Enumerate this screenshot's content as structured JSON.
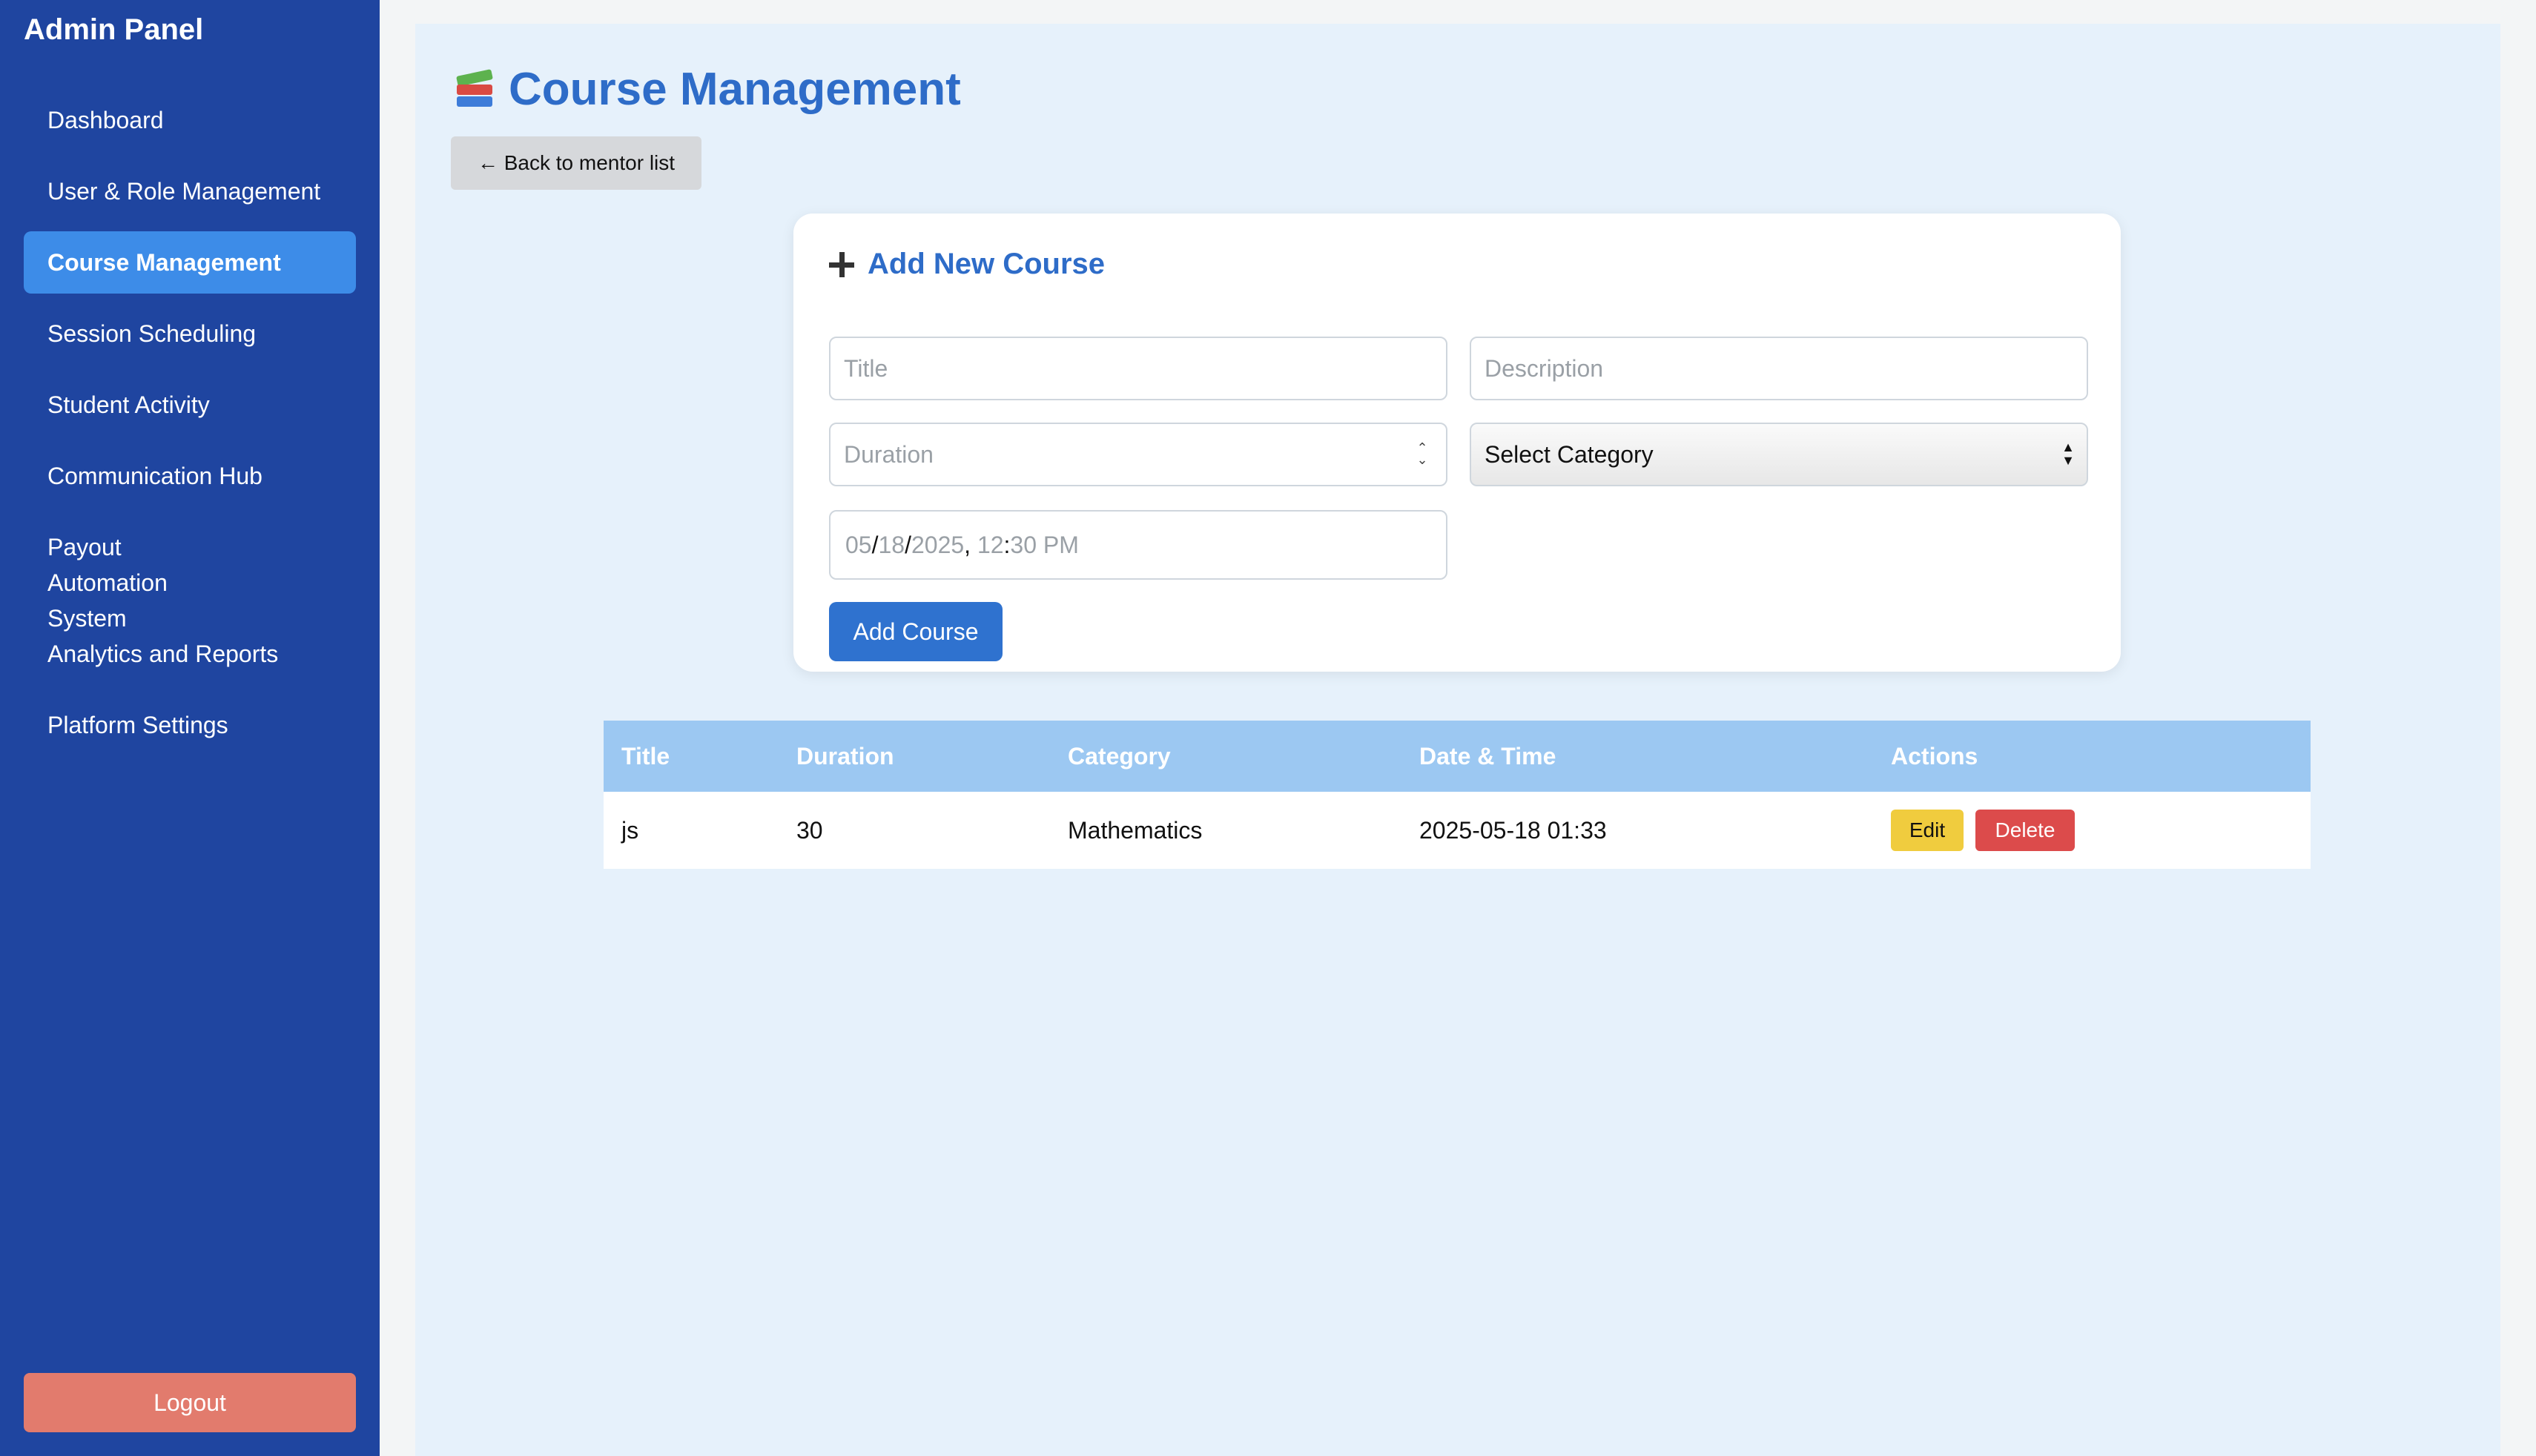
{
  "sidebar": {
    "title": "Admin Panel",
    "items": [
      {
        "label": "Dashboard"
      },
      {
        "label": "User & Role Management"
      },
      {
        "label": "Course Management",
        "active": true
      },
      {
        "label": "Session Scheduling"
      },
      {
        "label": "Student Activity"
      },
      {
        "label": "Communication Hub"
      },
      {
        "label": "Payout Automation System"
      },
      {
        "label": "Analytics and Reports"
      },
      {
        "label": "Platform Settings"
      }
    ],
    "logout_label": "Logout"
  },
  "main": {
    "title": "Course Management",
    "title_icon": "books-icon",
    "back_label": "← Back to mentor list"
  },
  "form": {
    "title": "Add New Course",
    "title_icon": "plus-icon",
    "title_placeholder": "Title",
    "description_placeholder": "Description",
    "duration_placeholder": "Duration",
    "category_selected": "Select Category",
    "datetime": {
      "month": "05",
      "day": "18",
      "year": "2025",
      "hour": "12",
      "minute": "30",
      "period": "PM"
    },
    "submit_label": "Add Course"
  },
  "table": {
    "headers": [
      "Title",
      "Duration",
      "Category",
      "Date & Time",
      "Actions"
    ],
    "rows": [
      {
        "title": "js",
        "duration": "30",
        "category": "Mathematics",
        "datetime": "2025-05-18 01:33",
        "edit_label": "Edit",
        "delete_label": "Delete"
      }
    ]
  },
  "colors": {
    "sidebar_bg": "#1f45a0",
    "active_item": "#3d8ce8",
    "accent": "#2e6cc8",
    "logout": "#e27b6d",
    "table_header": "#9cc8f2",
    "edit": "#f0cc3e",
    "delete": "#dc4b4b"
  }
}
